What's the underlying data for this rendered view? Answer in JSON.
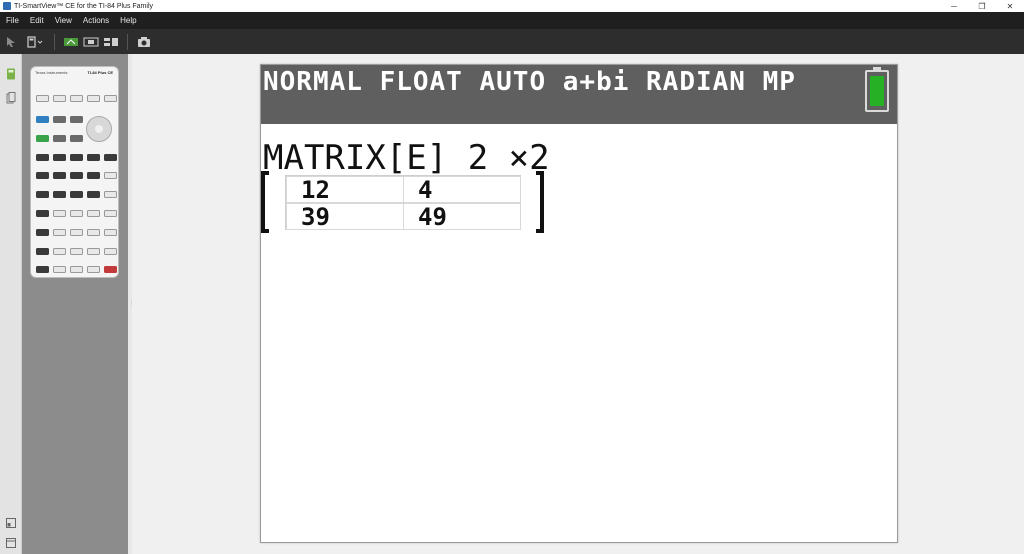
{
  "window": {
    "title": "TI-SmartView™ CE for the TI-84 Plus Family",
    "controls": {
      "minimize": "─",
      "restore": "❐",
      "close": "✕"
    }
  },
  "menu": [
    "File",
    "Edit",
    "View",
    "Actions",
    "Help"
  ],
  "toolbar": {
    "icons": [
      "pointer-icon",
      "calculator-view-icon",
      "key-press-history-icon",
      "emulator-icon",
      "screen-layout-icon",
      "screen-capture-icon"
    ]
  },
  "calculator": {
    "brand": "Texas Instruments",
    "model": "TI-84 Plus CE"
  },
  "screen": {
    "status_line": "NORMAL FLOAT AUTO a+bi RADIAN MP",
    "battery_level": 1.0,
    "matrix_title": "MATRIX[E] 2 ×2",
    "matrix": [
      [
        "12",
        "4"
      ],
      [
        "39",
        "49"
      ]
    ]
  }
}
